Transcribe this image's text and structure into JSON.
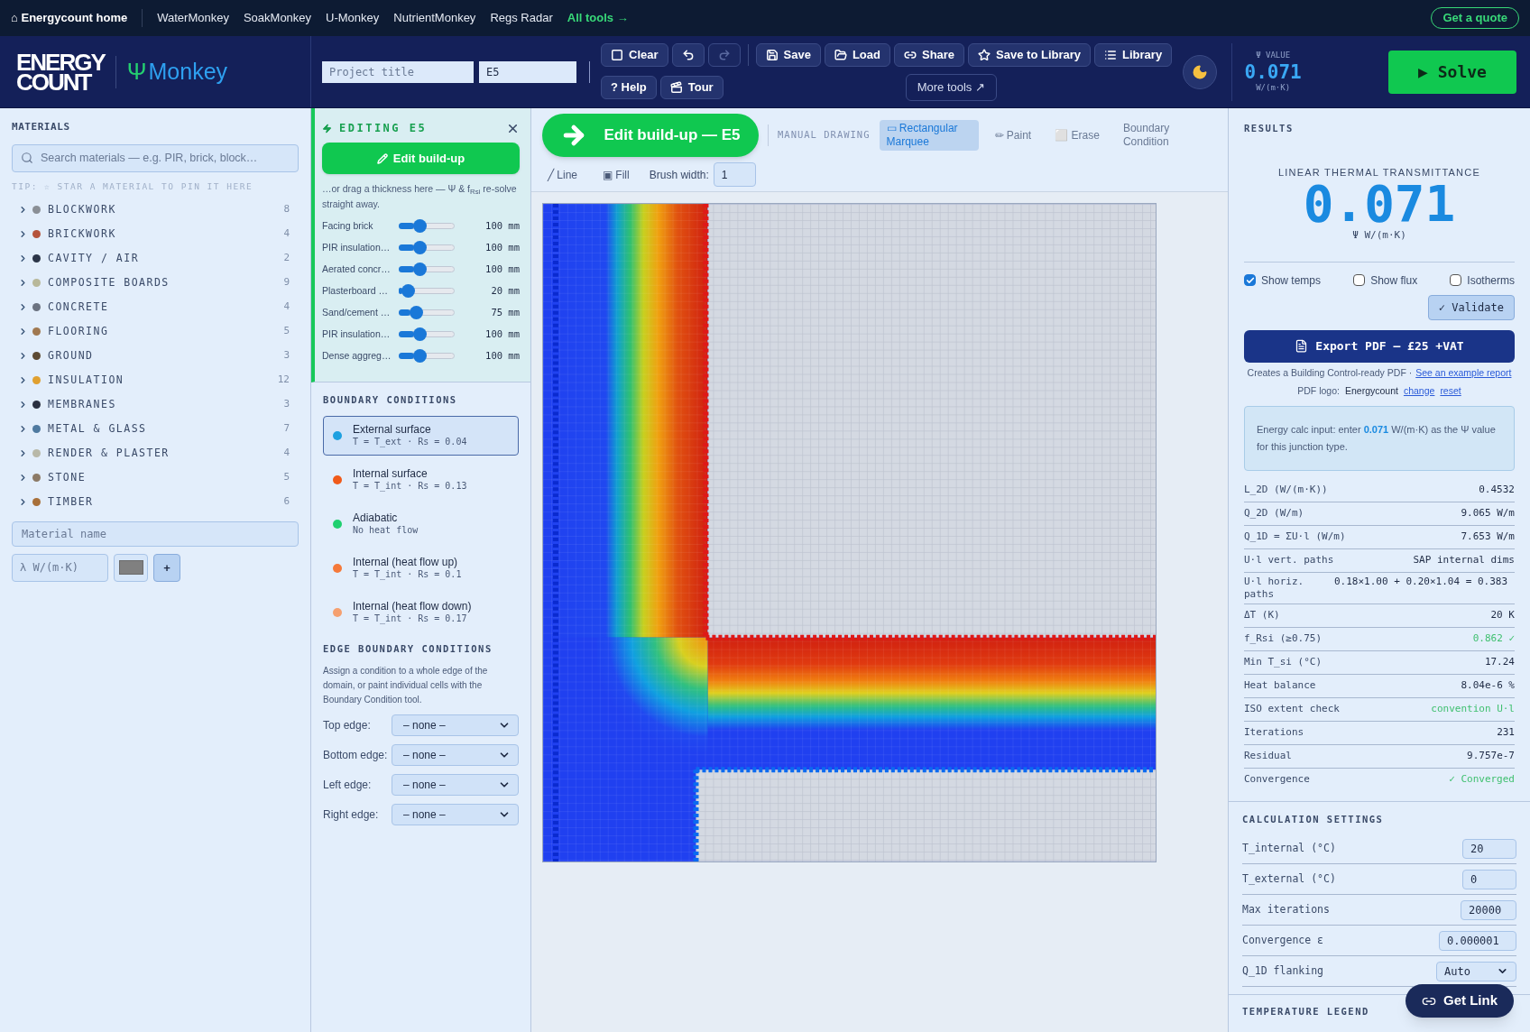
{
  "top_nav": {
    "home": "⌂ Energycount home",
    "links": [
      {
        "label": "WaterMonkey",
        "kind": "plain"
      },
      {
        "label": "SoakMonkey",
        "kind": "plain"
      },
      {
        "label": "U-Monkey",
        "kind": "plain"
      },
      {
        "label": "NutrientMonkey",
        "kind": "plain"
      },
      {
        "label": "Regs Radar",
        "kind": "plain"
      },
      {
        "label": "All tools →",
        "kind": "accent"
      }
    ],
    "cta": "Get a quote"
  },
  "header": {
    "logo_lines": [
      "ENERGY",
      "COUNT"
    ],
    "app_symbol": "Ψ",
    "app_name": "Monkey",
    "project_title": {
      "placeholder": "Project title"
    },
    "project_code": {
      "value": "E5"
    },
    "toolbar_row_1": [
      {
        "kind": "clear",
        "label": "Clear"
      },
      {
        "kind": "undo",
        "disabled": false
      },
      {
        "kind": "redo",
        "disabled": true
      },
      {
        "kind": "divider"
      },
      {
        "kind": "save",
        "label": "Save"
      },
      {
        "kind": "load",
        "label": "Load"
      },
      {
        "kind": "share",
        "label": "Share"
      },
      {
        "kind": "star",
        "label": "Save to Library"
      },
      {
        "kind": "library",
        "label": "Library"
      }
    ],
    "toolbar_row_2": [
      {
        "kind": "plain",
        "label": "? Help"
      },
      {
        "kind": "tour",
        "label": "Tour"
      }
    ],
    "more_tools": "More tools ↗",
    "psi": {
      "label": "Ψ VALUE",
      "value": "0.071",
      "unit": "W/(m·K)"
    },
    "solve": "▶ Solve"
  },
  "sidebar": {
    "title": "MATERIALS",
    "search": {
      "placeholder": "Search materials — e.g. PIR, brick, block…"
    },
    "tip": "TIP: ☆ STAR A MATERIAL TO PIN IT HERE",
    "categories": [
      {
        "name": "BLOCKWORK",
        "count": "8",
        "color": "#8a8f96",
        "expanded": false
      },
      {
        "name": "BRICKWORK",
        "count": "4",
        "color": "#b5533c",
        "expanded": false
      },
      {
        "name": "CAVITY / AIR",
        "count": "2",
        "color": "#2b3548",
        "expanded": false
      },
      {
        "name": "COMPOSITE BOARDS",
        "count": "9",
        "color": "#b8b89a",
        "expanded": false
      },
      {
        "name": "CONCRETE",
        "count": "4",
        "color": "#6b7280",
        "expanded": false
      },
      {
        "name": "FLOORING",
        "count": "5",
        "color": "#a07850",
        "expanded": false
      },
      {
        "name": "GROUND",
        "count": "3",
        "color": "#5c4a33",
        "expanded": false
      },
      {
        "name": "INSULATION",
        "count": "12",
        "color": "#e0a030",
        "expanded": false
      },
      {
        "name": "MEMBRANES",
        "count": "3",
        "color": "#2a3040",
        "expanded": false
      },
      {
        "name": "METAL & GLASS",
        "count": "7",
        "color": "#4f7aa0",
        "expanded": false
      },
      {
        "name": "RENDER & PLASTER",
        "count": "4",
        "color": "#b8b8a8",
        "expanded": false
      },
      {
        "name": "STONE",
        "count": "5",
        "color": "#8c7a66",
        "expanded": false
      },
      {
        "name": "TIMBER",
        "count": "6",
        "color": "#a8703a",
        "expanded": false
      }
    ],
    "new_material": {
      "name": {
        "placeholder": "Material name"
      },
      "lambda": {
        "placeholder": "λ W/(m·K)"
      },
      "add": "+"
    }
  },
  "editing": {
    "title": "EDITING E5",
    "button": "Edit build-up",
    "hint": "…or drag a thickness here — Ψ & f$_{Rsi}$ re-solve straight away.",
    "layers": [
      {
        "name": "Facing brick",
        "level": 0.33,
        "value": "100 mm"
      },
      {
        "name": "PIR insulation…",
        "level": 0.33,
        "value": "100 mm"
      },
      {
        "name": "Aerated concr…",
        "level": 0.33,
        "value": "100 mm"
      },
      {
        "name": "Plasterboard …",
        "level": 0.07,
        "value": "20 mm"
      },
      {
        "name": "Sand/cement …",
        "level": 0.25,
        "value": "75 mm"
      },
      {
        "name": "PIR insulation…",
        "level": 0.33,
        "value": "100 mm"
      },
      {
        "name": "Dense aggreg…",
        "level": 0.33,
        "value": "100 mm"
      }
    ]
  },
  "boundary_conditions": {
    "title": "BOUNDARY CONDITIONS",
    "items": [
      {
        "name": "External surface",
        "detail": "T = T_ext · Rs = 0.04",
        "color": "#1ea0e0",
        "selected": true
      },
      {
        "name": "Internal surface",
        "detail": "T = T_int · Rs = 0.13",
        "color": "#f05a1a",
        "selected": false
      },
      {
        "name": "Adiabatic",
        "detail": "No heat flow",
        "color": "#20d070",
        "selected": false
      },
      {
        "name": "Internal (heat flow up)",
        "detail": "T = T_int · Rs = 0.1",
        "color": "#f5793a",
        "selected": false
      },
      {
        "name": "Internal (heat flow down)",
        "detail": "T = T_int · Rs = 0.17",
        "color": "#f5a070",
        "selected": false
      }
    ]
  },
  "edge_conditions": {
    "title": "EDGE BOUNDARY CONDITIONS",
    "description": "Assign a condition to a whole edge of the domain, or paint individual cells with the Boundary Condition tool.",
    "edges": [
      {
        "label": "Top edge:",
        "value": "– none –"
      },
      {
        "label": "Bottom edge:",
        "value": "– none –"
      },
      {
        "label": "Left edge:",
        "value": "– none –"
      },
      {
        "label": "Right edge:",
        "value": "– none –"
      }
    ]
  },
  "canvas_toolbar": {
    "edit_button": "Edit build-up — E5",
    "section_label": "MANUAL DRAWING",
    "tools": [
      {
        "label": "▭ Rectangular Marquee",
        "selected": true
      },
      {
        "label": "✏ Paint",
        "selected": false
      },
      {
        "label": "⬜ Erase",
        "selected": false
      },
      {
        "label": "Boundary Condition",
        "selected": false
      }
    ],
    "tools_row_2": [
      {
        "label": "╱ Line",
        "selected": false
      },
      {
        "label": "▣ Fill",
        "selected": false
      }
    ],
    "brush_width": {
      "label": "Brush width:",
      "value": "1"
    }
  },
  "results": {
    "title": "RESULTS",
    "headline_label": "LINEAR THERMAL TRANSMITTANCE",
    "headline_value": "0.071",
    "headline_unit": "Ψ W/(m·K)",
    "toggles": [
      {
        "label": "Show temps",
        "checked": true
      },
      {
        "label": "Show flux",
        "checked": false
      },
      {
        "label": "Isotherms",
        "checked": false
      }
    ],
    "validate": "✓ Validate",
    "export": "Export PDF — £25 +VAT",
    "export_note": "Creates a Building Control-ready PDF ·",
    "example_link": "See an example report",
    "pdf_logo": {
      "label": "PDF logo:",
      "value": "Energycount",
      "change": "change",
      "reset": "reset"
    },
    "info": "Energy calc input: enter **0.071** W/(m·K) as the Ψ value for this junction type.",
    "metrics": [
      {
        "label": "L_2D (W/(m·K))",
        "value": "0.4532",
        "kind": "plain"
      },
      {
        "label": "Q_2D (W/m)",
        "value": "9.065 W/m",
        "kind": "plain"
      },
      {
        "label": "Q_1D = ΣU·l (W/m)",
        "value": "7.653 W/m",
        "kind": "plain"
      },
      {
        "label": "U·l vert. paths",
        "value": "SAP internal dims",
        "kind": "plain"
      },
      {
        "label": "U·l horiz. paths",
        "value": "0.18×1.00 + 0.20×1.04 = 0.383",
        "kind": "wide"
      },
      {
        "label": "ΔT (K)",
        "value": "20 K",
        "kind": "plain"
      },
      {
        "label": "f_Rsi (≥0.75)",
        "value": "0.862 ✓",
        "kind": "good"
      },
      {
        "label": "Min T_si (°C)",
        "value": "17.24",
        "kind": "plain"
      },
      {
        "label": "Heat balance",
        "value": "8.04e-6 %",
        "kind": "plain"
      },
      {
        "label": "ISO extent check",
        "value": "convention U·l",
        "kind": "good"
      },
      {
        "label": "Iterations",
        "value": "231",
        "kind": "plain"
      },
      {
        "label": "Residual",
        "value": "9.757e-7",
        "kind": "plain"
      },
      {
        "label": "Convergence",
        "value": "✓ Converged",
        "kind": "good"
      }
    ]
  },
  "calculation_settings": {
    "title": "CALCULATION SETTINGS",
    "fields": [
      {
        "label": "T_internal (°C)",
        "value": "20",
        "kind": "input"
      },
      {
        "label": "T_external (°C)",
        "value": "0",
        "kind": "input"
      },
      {
        "label": "Max iterations",
        "value": "20000",
        "kind": "input"
      },
      {
        "label": "Convergence ε",
        "value": "0.000001",
        "kind": "input"
      },
      {
        "label": "Q_1D flanking",
        "value": "Auto",
        "kind": "select"
      }
    ]
  },
  "temperature_legend": {
    "title": "TEMPERATURE LEGEND"
  },
  "get_link": "Get Link"
}
